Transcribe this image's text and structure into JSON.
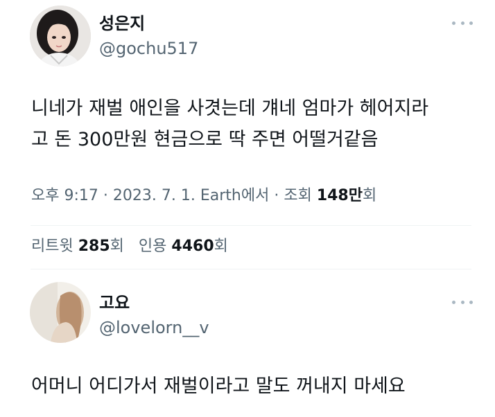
{
  "tweet": {
    "author": {
      "name": "성은지",
      "handle": "@gochu517"
    },
    "text_line1": "니네가 재벌 애인을 사겻는데 걔네 엄마가 헤어지라",
    "text_line2": "고 돈 300만원 현금으로 딱 주면 어떨거같음",
    "meta": {
      "time": "오후 9:17",
      "sep1": "·",
      "date": "2023. 7. 1.",
      "source": "Earth에서",
      "sep2": "·",
      "views_label": "조회",
      "views_value": "148만",
      "views_unit": "회"
    },
    "stats": {
      "retweets_label": "리트윗",
      "retweets_value": "285",
      "retweets_unit": "회",
      "quotes_label": "인용",
      "quotes_value": "4460",
      "quotes_unit": "회"
    }
  },
  "reply": {
    "author": {
      "name": "고요",
      "handle": "@lovelorn__v"
    },
    "text": "어머니 어디가서 재벌이라고 말도 꺼내지 마세요"
  },
  "icons": {
    "more": "more-horizontal-icon"
  }
}
